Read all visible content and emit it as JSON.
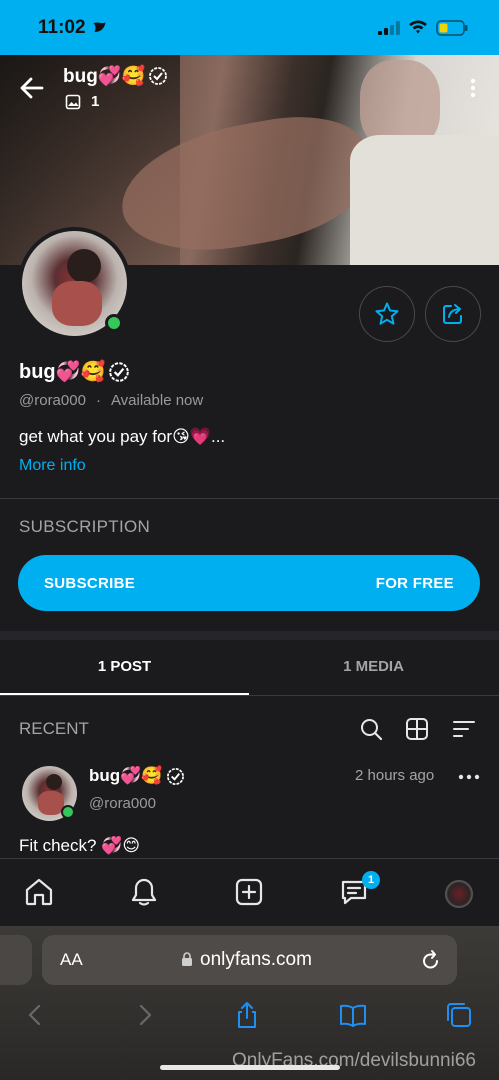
{
  "status_bar": {
    "time": "11:02"
  },
  "cover": {
    "name": "bug💞🥰",
    "media_count": "1"
  },
  "profile": {
    "name": "bug💞🥰",
    "handle": "@rora000",
    "separator": "·",
    "availability": "Available now",
    "bio": "get what you pay for😘💗...",
    "more_info": "More info"
  },
  "subscription": {
    "title": "SUBSCRIPTION",
    "subscribe_label": "SUBSCRIBE",
    "price_label": "FOR FREE"
  },
  "tabs": [
    {
      "label": "1 POST",
      "active": true
    },
    {
      "label": "1 MEDIA",
      "active": false
    }
  ],
  "recent": {
    "title": "RECENT"
  },
  "post": {
    "name": "bug💞🥰",
    "handle": "@rora000",
    "time": "2 hours ago",
    "text": "Fit check? 💞😊"
  },
  "bottom_nav": {
    "items": [
      "home-icon",
      "bell-icon",
      "add-post-icon",
      "messages-icon",
      "profile-avatar"
    ],
    "messages_badge": "1"
  },
  "browser": {
    "aa_label": "AA",
    "url": "onlyfans.com"
  },
  "watermark": "OnlyFans.com/devilsbunni66",
  "colors": {
    "accent": "#00aff0",
    "online": "#35c759",
    "background": "#1b1b1d"
  }
}
